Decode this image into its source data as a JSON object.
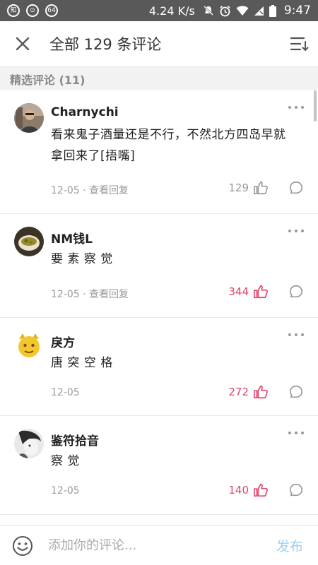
{
  "status_bar": {
    "icon_1": "知",
    "icon_2": "⊙",
    "icon_3": "64",
    "net_speed": "4.24 K/s",
    "time": "9:47"
  },
  "header": {
    "title": "全部 129 条评论"
  },
  "section": {
    "label": "精选评论 (11)"
  },
  "comments": [
    {
      "username": "Charnychi",
      "text": "看来鬼子酒量还是不行，不然北方四岛早就拿回来了[捂嘴]",
      "meta": "12-05 · 查看回复",
      "likes": "129",
      "liked": false
    },
    {
      "username": "NM钱L",
      "text": "要 素 察 觉",
      "meta": "12-05 · 查看回复",
      "likes": "344",
      "liked": true
    },
    {
      "username": "戾方",
      "text": "唐 突 空 格",
      "meta": "12-05",
      "likes": "272",
      "liked": true
    },
    {
      "username": "鉴符拾音",
      "text": "察 觉",
      "meta": "12-05",
      "likes": "140",
      "liked": true
    }
  ],
  "composer": {
    "placeholder": "添加你的评论...",
    "publish_label": "发布"
  },
  "colors": {
    "accent_like": "#e0456a",
    "muted": "#999999",
    "publish_disabled": "#9fd1f0"
  }
}
